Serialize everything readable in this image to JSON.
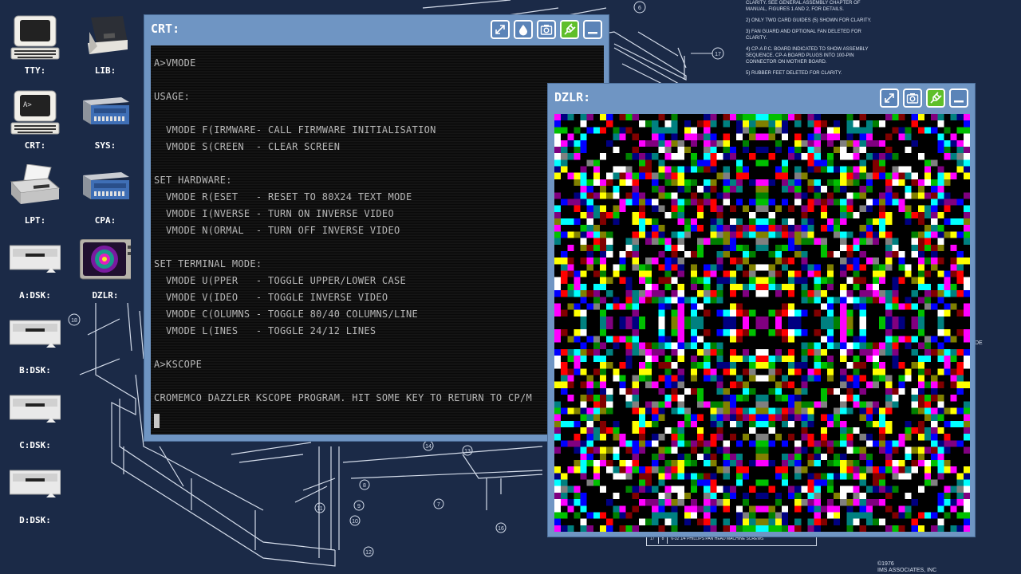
{
  "desktop": {
    "icons": [
      {
        "label": "TTY:",
        "icon": "terminal-icon"
      },
      {
        "label": "LIB:",
        "icon": "tape-drive-icon"
      },
      {
        "label": "CRT:",
        "icon": "crt-terminal-icon"
      },
      {
        "label": "SYS:",
        "icon": "computer-box-icon"
      },
      {
        "label": "LPT:",
        "icon": "printer-icon"
      },
      {
        "label": "CPA:",
        "icon": "computer-box-icon"
      },
      {
        "label": "A:DSK:",
        "icon": "disk-drive-icon"
      },
      {
        "label": "DZLR:",
        "icon": "dazzler-tv-icon"
      },
      {
        "label": "B:DSK:",
        "icon": "disk-drive-icon"
      },
      {
        "label": "C:DSK:",
        "icon": "disk-drive-icon"
      },
      {
        "label": "D:DSK:",
        "icon": "disk-drive-icon"
      }
    ]
  },
  "blueprint": {
    "notes": [
      "CLARITY. SEE GENERAL ASSEMBLY CHAPTER OF MANUAL, FIGURES 1 AND 2, FOR DETAILS.",
      "2) ONLY TWO CARD GUIDES (5) SHOWN FOR CLARITY.",
      "3) FAN GUARD AND OPTIONAL FAN DELETED FOR CLARITY.",
      "4) CP-A P.C. BOARD INDICATED TO SHOW ASSEMBLY SEQUENCE. CP-A BOARD PLUGS INTO 100-PIN CONNECTOR ON MOTHER BOARD.",
      "5) RUBBER FEET DELETED FOR CLARITY."
    ],
    "copyright_line1": "©1976",
    "copyright_line2": "IMS ASSOCIATES, INC",
    "table_row": [
      "17",
      "8",
      "6-32 1/4 PHILLIPS PAN HEAD MACHINE SCREWS"
    ],
    "side_text": "DE",
    "callouts": [
      "6",
      "17",
      "18",
      "14",
      "13",
      "8",
      "9",
      "7",
      "11",
      "10",
      "16",
      "12"
    ]
  },
  "crt_window": {
    "title": "CRT:",
    "buttons": [
      "expand-icon",
      "drop-icon",
      "camera-icon",
      "plug-icon",
      "minimize-icon"
    ],
    "lines": [
      "A>VMODE",
      "",
      "USAGE:",
      "",
      "  VMODE F(IRMWARE- CALL FIRMWARE INITIALISATION",
      "  VMODE S(CREEN  - CLEAR SCREEN",
      "",
      "SET HARDWARE:",
      "  VMODE R(ESET   - RESET TO 80X24 TEXT MODE",
      "  VMODE I(NVERSE - TURN ON INVERSE VIDEO",
      "  VMODE N(ORMAL  - TURN OFF INVERSE VIDEO",
      "",
      "SET TERMINAL MODE:",
      "  VMODE U(PPER   - TOGGLE UPPER/LOWER CASE",
      "  VMODE V(IDEO   - TOGGLE INVERSE VIDEO",
      "  VMODE C(OLUMNS - TOGGLE 80/40 COLUMNS/LINE",
      "  VMODE L(INES   - TOGGLE 24/12 LINES",
      "",
      "A>KSCOPE",
      "",
      "CROMEMCO DAZZLER KSCOPE PROGRAM. HIT SOME KEY TO RETURN TO CP/M"
    ]
  },
  "dzlr_window": {
    "title": "DZLR:",
    "buttons": [
      "expand-icon",
      "camera-icon",
      "plug-icon",
      "minimize-icon"
    ],
    "palette": [
      "#000000",
      "#ff0000",
      "#00c000",
      "#ffff00",
      "#0000ff",
      "#ff00ff",
      "#00ffff",
      "#ffffff",
      "#808080",
      "#808000",
      "#008080",
      "#800080",
      "#008000",
      "#800000",
      "#000080"
    ]
  },
  "colors": {
    "desktop_bg": "#1b2a47",
    "window_chrome": "#6f95c3",
    "plug_button": "#5fbf2a"
  }
}
